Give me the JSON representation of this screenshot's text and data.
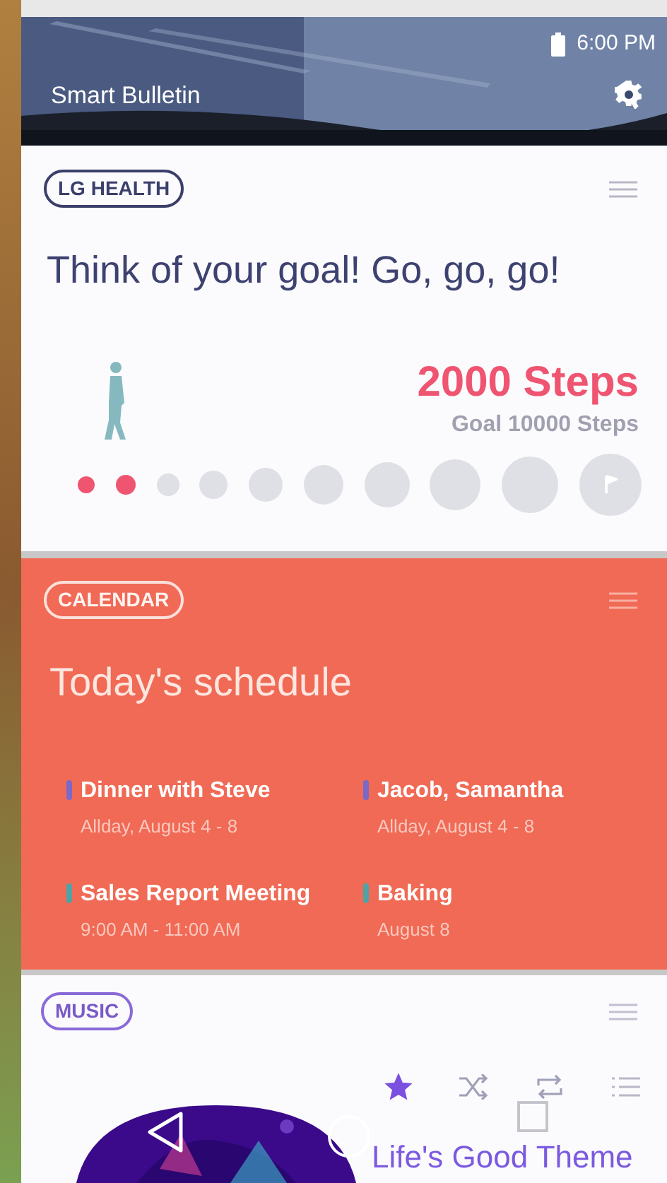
{
  "status_bar": {
    "time": "6:00 PM"
  },
  "header": {
    "title": "Smart Bulletin"
  },
  "health": {
    "tag": "LG HEALTH",
    "headline": "Think of your goal! Go, go, go!",
    "steps": "2000 Steps",
    "goal": "Goal 10000 Steps",
    "dots": [
      {
        "done": true
      },
      {
        "done": true
      },
      {
        "done": false
      },
      {
        "done": false
      },
      {
        "done": false
      },
      {
        "done": false
      },
      {
        "done": false
      },
      {
        "done": false
      },
      {
        "done": false
      },
      {
        "done": false,
        "kind": "flag"
      }
    ]
  },
  "calendar": {
    "tag": "CALENDAR",
    "headline": "Today's schedule",
    "events": [
      {
        "title": "Dinner with Steve",
        "time": "Allday, August 4 - 8",
        "color": "#7b68c8"
      },
      {
        "title": "Jacob, Samantha",
        "time": "Allday, August 4 - 8",
        "color": "#7b68c8"
      },
      {
        "title": "Sales Report Meeting",
        "time": "9:00 AM - 11:00 AM",
        "color": "#4fa3a5"
      },
      {
        "title": "Baking",
        "time": "August 8",
        "color": "#4fa3a5"
      }
    ]
  },
  "music": {
    "tag": "MUSIC",
    "favorite": true,
    "track": "Life's Good Theme"
  }
}
